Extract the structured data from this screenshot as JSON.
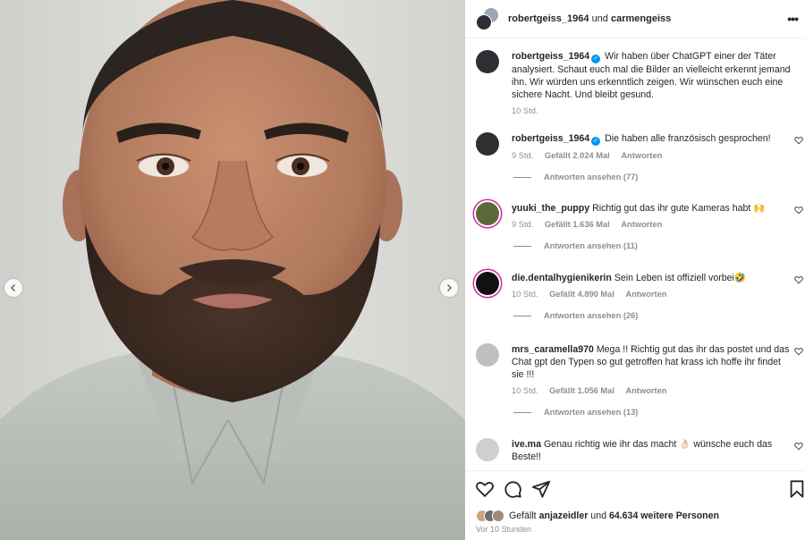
{
  "header": {
    "user1": "robertgeiss_1964",
    "connector": "und",
    "user2": "carmengeiss",
    "more_icon": "more-horizontal-icon"
  },
  "caption": {
    "username": "robertgeiss_1964",
    "verified": true,
    "text": "Wir haben über ChatGPT einer der Täter analysiert. Schaut euch mal die Bilder an vielleicht erkennt jemand ihn. Wir würden uns erkenntlich zeigen. Wir wünschen euch eine sichere Nacht. Und bleibt gesund.",
    "time": "10 Std."
  },
  "comments": [
    {
      "username": "robertgeiss_1964",
      "verified": true,
      "text": "Die haben alle französisch gesprochen!",
      "time": "9 Std.",
      "likes": "Gefällt 2.024 Mal",
      "reply": "Antworten",
      "view_replies": "Antworten ansehen (77)"
    },
    {
      "username": "yuuki_the_puppy",
      "verified": false,
      "text": "Richtig gut das ihr gute Kameras habt 🙌",
      "time": "9 Std.",
      "likes": "Gefällt 1.636 Mal",
      "reply": "Antworten",
      "view_replies": "Antworten ansehen (11)"
    },
    {
      "username": "die.dentalhygienikerin",
      "verified": false,
      "text": "Sein Leben ist offiziell vorbei🤣",
      "time": "10 Std.",
      "likes": "Gefällt 4.890 Mal",
      "reply": "Antworten",
      "view_replies": "Antworten ansehen (26)"
    },
    {
      "username": "mrs_caramella970",
      "verified": false,
      "text": "Mega !! Richtig gut das ihr das postet und das Chat gpt den Typen so gut getroffen hat krass ich hoffe ihr findet sie !!!",
      "time": "10 Std.",
      "likes": "Gefällt 1.056 Mal",
      "reply": "Antworten",
      "view_replies": "Antworten ansehen (13)"
    },
    {
      "username": "ive.ma",
      "verified": false,
      "text": "Genau richtig wie ihr das macht 👌🏻 wünsche euch das Beste!!",
      "time": "",
      "likes": "",
      "reply": "",
      "view_replies": ""
    }
  ],
  "actions": {
    "icons": [
      "heart-icon",
      "comment-icon",
      "share-icon",
      "bookmark-icon"
    ],
    "liked_by_prefix": "Gefällt",
    "liked_by_user": "anjazeidler",
    "liked_by_and": "und",
    "liked_by_others": "64.634 weitere Personen",
    "time_ago": "Vor 10 Stunden"
  },
  "colors": {
    "verified": "#0095f6",
    "meta": "#8e8e8e",
    "story_ring": "#d6249f"
  }
}
